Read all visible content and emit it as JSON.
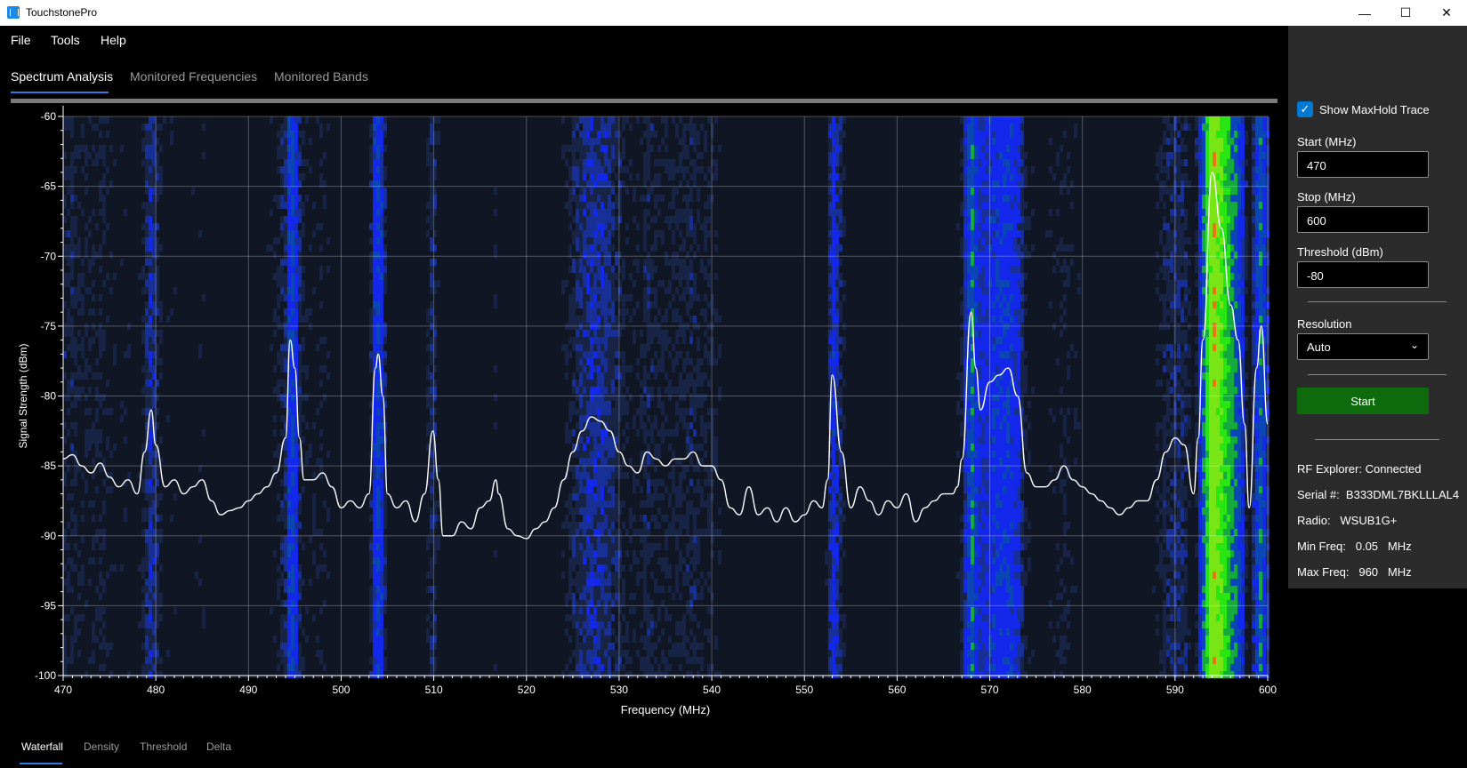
{
  "window": {
    "title": "TouchstonePro",
    "minimize": "—",
    "maximize": "☐",
    "close": "✕"
  },
  "menu": {
    "file": "File",
    "tools": "Tools",
    "help": "Help"
  },
  "tabs": {
    "spectrum": "Spectrum Analysis",
    "monitored_freq": "Monitored Frequencies",
    "monitored_bands": "Monitored Bands"
  },
  "bottom_tabs": {
    "waterfall": "Waterfall",
    "density": "Density",
    "threshold": "Threshold",
    "delta": "Delta"
  },
  "panel": {
    "show_maxhold": "Show MaxHold Trace",
    "show_maxhold_checked": true,
    "start_label": "Start (MHz)",
    "start_value": "470",
    "stop_label": "Stop (MHz)",
    "stop_value": "600",
    "threshold_label": "Threshold (dBm)",
    "threshold_value": "-80",
    "resolution_label": "Resolution",
    "resolution_value": "Auto",
    "start_button": "Start",
    "status": "RF Explorer: Connected",
    "serial": "Serial #:  B333DML7BKLLLAL4",
    "radio": "Radio:   WSUB1G+",
    "min_freq": "Min Freq:   0.05   MHz",
    "max_freq": "Max Freq:   960   MHz"
  },
  "icons": {
    "app": "waveform-icon",
    "check": "checkmark-icon",
    "dropdown": "chevron-down-icon"
  },
  "colors": {
    "accent": "#2f7be0",
    "start_button": "#0d6b0d",
    "panel_bg": "#2b2b2b"
  },
  "chart_data": {
    "type": "line",
    "xlabel": "Frequency (MHz)",
    "ylabel": "Signal Strength (dBm)",
    "xlim": [
      470,
      600
    ],
    "ylim": [
      -100,
      -60
    ],
    "x_ticks": [
      "470",
      "480",
      "490",
      "500",
      "510",
      "520",
      "530",
      "540",
      "550",
      "560",
      "570",
      "580",
      "590",
      "600"
    ],
    "y_ticks": [
      "-60",
      "-65",
      "-70",
      "-75",
      "-80",
      "-85",
      "-90",
      "-95",
      "-100"
    ],
    "grid": true,
    "series": [
      {
        "values_x": [
          470,
          471,
          472,
          473,
          474,
          475,
          476,
          477,
          478,
          478.8,
          479.5,
          480,
          481,
          482,
          483,
          484,
          485,
          486,
          487,
          488,
          489,
          490,
          491,
          492,
          493,
          494,
          494.5,
          495,
          495.5,
          496,
          497,
          498,
          499,
          500,
          501,
          502,
          503,
          503.7,
          504,
          504.5,
          505,
          506,
          507,
          508,
          509,
          509.9,
          510.5,
          511,
          512,
          513,
          514,
          515,
          516,
          516.7,
          517,
          518,
          519,
          520,
          521,
          522,
          523,
          524,
          525,
          526,
          527,
          528,
          529,
          530,
          531,
          532,
          533,
          534,
          535,
          536,
          537,
          538,
          539,
          540,
          541,
          542,
          543,
          544,
          545,
          546,
          547,
          548,
          549,
          550,
          551,
          551.9,
          552.5,
          553,
          554,
          555,
          556,
          557,
          558,
          559,
          560,
          561,
          562,
          563,
          564,
          565,
          566,
          566.5,
          567,
          568,
          568.5,
          569,
          570,
          571,
          572,
          573,
          574,
          575,
          576,
          577,
          578,
          579,
          580,
          581,
          582,
          583,
          584,
          585,
          586,
          587,
          588,
          589,
          590,
          591,
          592,
          592.5,
          593,
          594,
          595,
          596,
          596.8,
          597.5,
          598,
          598.8,
          599.3,
          600
        ],
        "values_y": [
          -84.5,
          -84.2,
          -85,
          -85.5,
          -84.8,
          -85.8,
          -86.5,
          -86,
          -87,
          -84,
          -81,
          -83.5,
          -86.5,
          -86,
          -87,
          -86.5,
          -86,
          -87.5,
          -88.5,
          -88.2,
          -88,
          -87.5,
          -87,
          -86.5,
          -85.5,
          -83,
          -76,
          -78,
          -83,
          -86,
          -86,
          -85.5,
          -86.5,
          -88,
          -87.5,
          -88,
          -87,
          -78,
          -77,
          -80,
          -87,
          -88,
          -87.5,
          -89,
          -87,
          -82.5,
          -86,
          -90,
          -90,
          -89,
          -89.5,
          -88,
          -87.5,
          -86,
          -87,
          -89.5,
          -90,
          -90.2,
          -89.5,
          -89,
          -88,
          -86,
          -84,
          -82.5,
          -81.5,
          -81.8,
          -82.5,
          -84,
          -85,
          -85.5,
          -84,
          -84.5,
          -85,
          -84.5,
          -84.5,
          -84,
          -85,
          -85,
          -86,
          -88,
          -88.5,
          -86.5,
          -88.5,
          -88,
          -89,
          -88,
          -89,
          -88.5,
          -87.5,
          -88,
          -86,
          -78.5,
          -84,
          -88,
          -86.5,
          -87.5,
          -88.5,
          -87.5,
          -88,
          -87,
          -89,
          -88,
          -87.5,
          -87,
          -87,
          -86.5,
          -84.5,
          -74,
          -78,
          -81,
          -79,
          -78.5,
          -78,
          -80,
          -85.5,
          -86.5,
          -86.5,
          -86,
          -85,
          -86,
          -86.5,
          -87,
          -87.5,
          -88,
          -88.5,
          -88,
          -87.5,
          -87.5,
          -86,
          -84,
          -83,
          -83.5,
          -87,
          -83,
          -76,
          -64,
          -68,
          -73.5,
          -76,
          -82,
          -88,
          -78,
          -75,
          -82,
          -89,
          -86
        ]
      }
    ]
  }
}
